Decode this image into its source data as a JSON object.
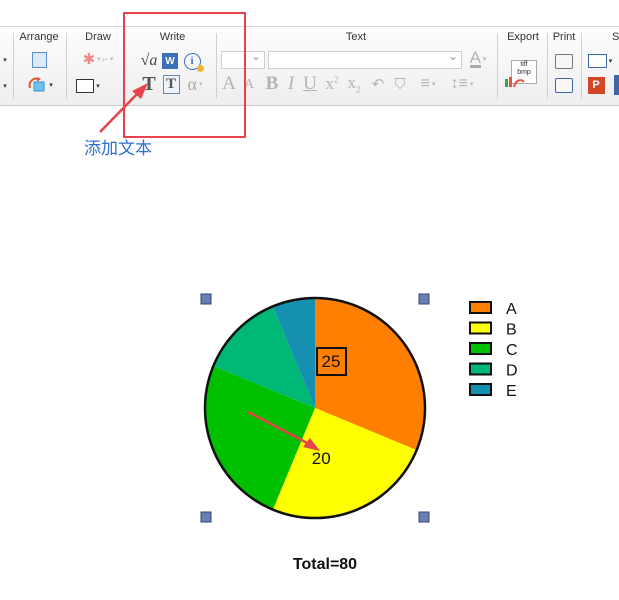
{
  "toolbar": {
    "groups": {
      "arrange": "Arrange",
      "draw": "Draw",
      "write": "Write",
      "text": "Text",
      "export": "Export",
      "print": "Print",
      "share_partial": "S"
    },
    "icons": {
      "export_file_label_1": "tiff",
      "export_file_label_2": "bmp",
      "word_label": "W",
      "ppt_label": "P"
    }
  },
  "annotation": {
    "note": "添加文本",
    "box_color": "#e8424a",
    "arrow_color": "#e8424a",
    "note_color": "#2f6fd1"
  },
  "chart_data": {
    "type": "pie",
    "categories": [
      "A",
      "B",
      "C",
      "D",
      "E"
    ],
    "values": [
      25,
      20,
      20,
      10,
      5
    ],
    "colors": [
      "#ff8000",
      "#ffff00",
      "#00c000",
      "#00b875",
      "#1590b0"
    ],
    "slice_labels": [
      {
        "category": "A",
        "text": "25",
        "boxed": true
      },
      {
        "category": "B",
        "text": "20",
        "boxed": false
      }
    ],
    "legend": {
      "placement": "right",
      "entries": [
        "A",
        "B",
        "C",
        "D",
        "E"
      ]
    },
    "total_label": "Total=80",
    "start": "top",
    "direction": "clockwise"
  }
}
